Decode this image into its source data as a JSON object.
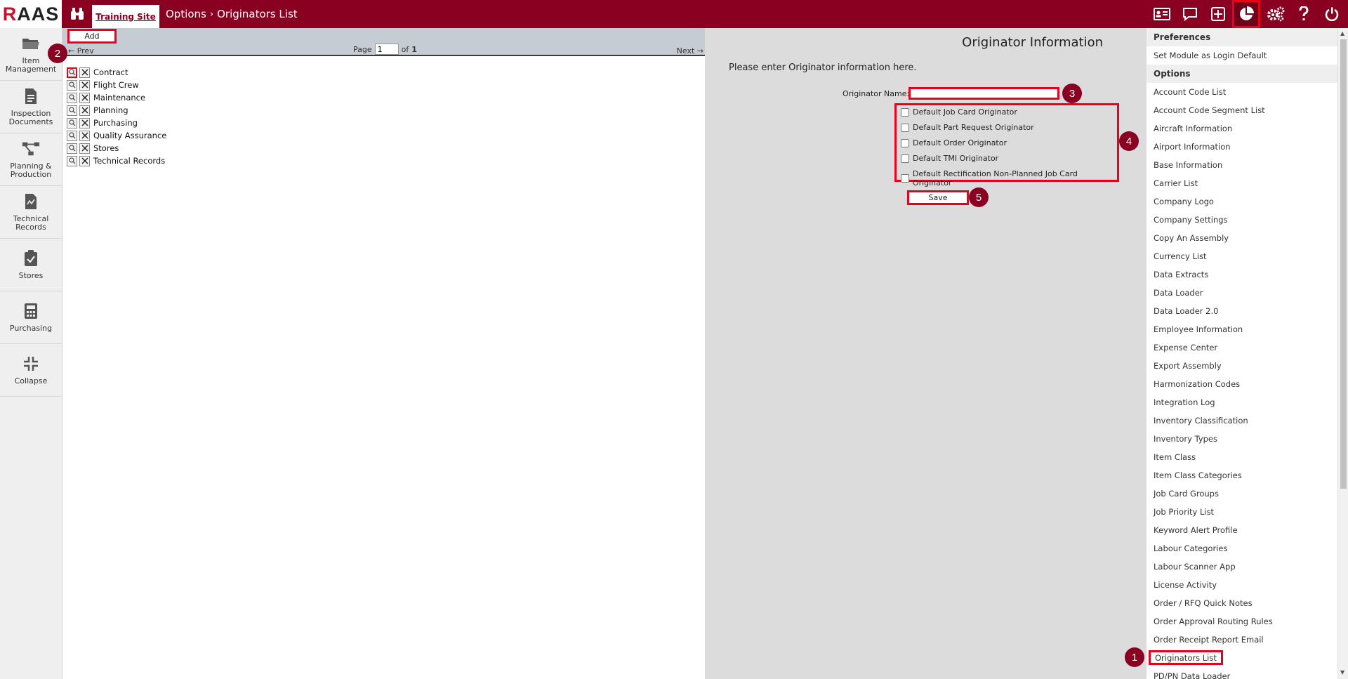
{
  "app": {
    "logo_r": "R",
    "logo_rest": "AAS"
  },
  "topbar": {
    "site_tab": "Training Site",
    "breadcrumb_parent": "Options",
    "breadcrumb_sep": "›",
    "breadcrumb_current": "Originators List",
    "icons": [
      "contact-card-icon",
      "message-icon",
      "add-square-icon",
      "pie-chart-icon",
      "gears-icon",
      "help-icon",
      "power-icon"
    ],
    "active_icon": "pie-chart-icon"
  },
  "leftnav": {
    "items": [
      {
        "label": "Item Management",
        "icon": "folder-icon"
      },
      {
        "label": "Inspection Documents",
        "icon": "document-icon"
      },
      {
        "label": "Planning & Production",
        "icon": "planning-icon"
      },
      {
        "label": "Technical Records",
        "icon": "tech-records-icon"
      },
      {
        "label": "Stores",
        "icon": "clipboard-check-icon"
      },
      {
        "label": "Purchasing",
        "icon": "calculator-icon"
      },
      {
        "label": "Collapse",
        "icon": "collapse-icon"
      }
    ]
  },
  "list": {
    "add_label": "Add",
    "prev_label": "← Prev",
    "next_label": "Next →",
    "page_label": "Page",
    "page_value": "1",
    "of_label": "of",
    "page_total": "1",
    "rows": [
      "Contract",
      "Flight Crew",
      "Maintenance",
      "Planning",
      "Purchasing",
      "Quality Assurance",
      "Stores",
      "Technical Records"
    ]
  },
  "form": {
    "title": "Originator Information",
    "intro": "Please enter Originator information here.",
    "name_label": "Originator Name:",
    "name_value": "",
    "checkboxes": [
      "Default Job Card Originator",
      "Default Part Request Originator",
      "Default Order Originator",
      "Default TMI Originator",
      "Default Rectification Non-Planned Job Card Originator"
    ],
    "save_label": "Save"
  },
  "rightpanel": {
    "preferences_header": "Preferences",
    "preferences_items": [
      "Set Module as Login Default"
    ],
    "options_header": "Options",
    "options_items": [
      "Account Code List",
      "Account Code Segment List",
      "Aircraft Information",
      "Airport Information",
      "Base Information",
      "Carrier List",
      "Company Logo",
      "Company Settings",
      "Copy An Assembly",
      "Currency List",
      "Data Extracts",
      "Data Loader",
      "Data Loader 2.0",
      "Employee Information",
      "Expense Center",
      "Export Assembly",
      "Harmonization Codes",
      "Integration Log",
      "Inventory Classification",
      "Inventory Types",
      "Item Class",
      "Item Class Categories",
      "Job Card Groups",
      "Job Priority List",
      "Keyword Alert Profile",
      "Labour Categories",
      "Labour Scanner App",
      "License Activity",
      "Order / RFQ Quick Notes",
      "Order Approval Routing Rules",
      "Order Receipt Report Email",
      "Originators List",
      "PD/PN Data Loader"
    ],
    "active_item": "Originators List"
  },
  "badges": [
    "1",
    "2",
    "3",
    "4",
    "5"
  ],
  "colors": {
    "brand": "#8a0021",
    "highlight": "#e8001c",
    "nav_bg": "#efefef",
    "list_head": "#c5ccd3",
    "form_bg": "#dcdcdc"
  }
}
